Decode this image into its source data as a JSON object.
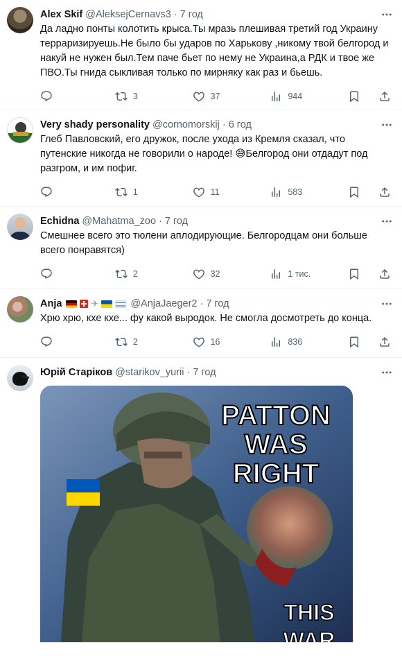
{
  "posts": [
    {
      "name": "Alex Skif",
      "handle": "@AleksejCernavs3",
      "time": "7 год",
      "text": "Да ладно понты колотить крыса.Ты мразь плешивая третий год Украину терраризируешь.Не было бы ударов по Харькову ,никому твой белгород и накуй не нужен был.Тем паче бьет по нему не Украина,а РДК и твое же ПВО.Ты гнида сыкливая только по мирняку как раз и бьешь.",
      "replies": "",
      "reposts": "3",
      "likes": "37",
      "views": "944"
    },
    {
      "name": "Very shady personality",
      "handle": "@cornomorskij",
      "time": "6 год",
      "text": "Глеб Павловский, его дружок, после ухода из Кремля сказал, что путенские никогда не говорили о народе! 😅Белгород они отдадут под разгром, и им пофиг.",
      "replies": "",
      "reposts": "1",
      "likes": "11",
      "views": "583"
    },
    {
      "name": "Echidna",
      "handle": "@Mahatma_zoo",
      "time": "7 год",
      "text": "Смешнее всего это тюлени аплодирующие. Белгородцам они больше всего понравятся)",
      "replies": "",
      "reposts": "2",
      "likes": "32",
      "views": "1 тис."
    },
    {
      "name": "Anja",
      "handle": "@AnjaJaeger2",
      "time": "7 год",
      "text": "Хрю хрю, кхе кхе... фу какой выродок. Не смогла досмотреть до конца.",
      "replies": "",
      "reposts": "2",
      "likes": "16",
      "views": "836"
    },
    {
      "name": "Юрій Старіков",
      "handle": "@starikov_yurii",
      "time": "7 год",
      "image_text": {
        "line1": "PATTON",
        "line2": "WAS",
        "line3": "RIGHT",
        "line4": "THIS",
        "line5": "WAR"
      }
    }
  ],
  "colors": {
    "text": "#0f1419",
    "secondary": "#536471",
    "divider": "#eff3f4"
  },
  "icons": [
    "reply-icon",
    "repost-icon",
    "like-icon",
    "views-icon",
    "bookmark-icon",
    "share-icon",
    "more-icon"
  ]
}
